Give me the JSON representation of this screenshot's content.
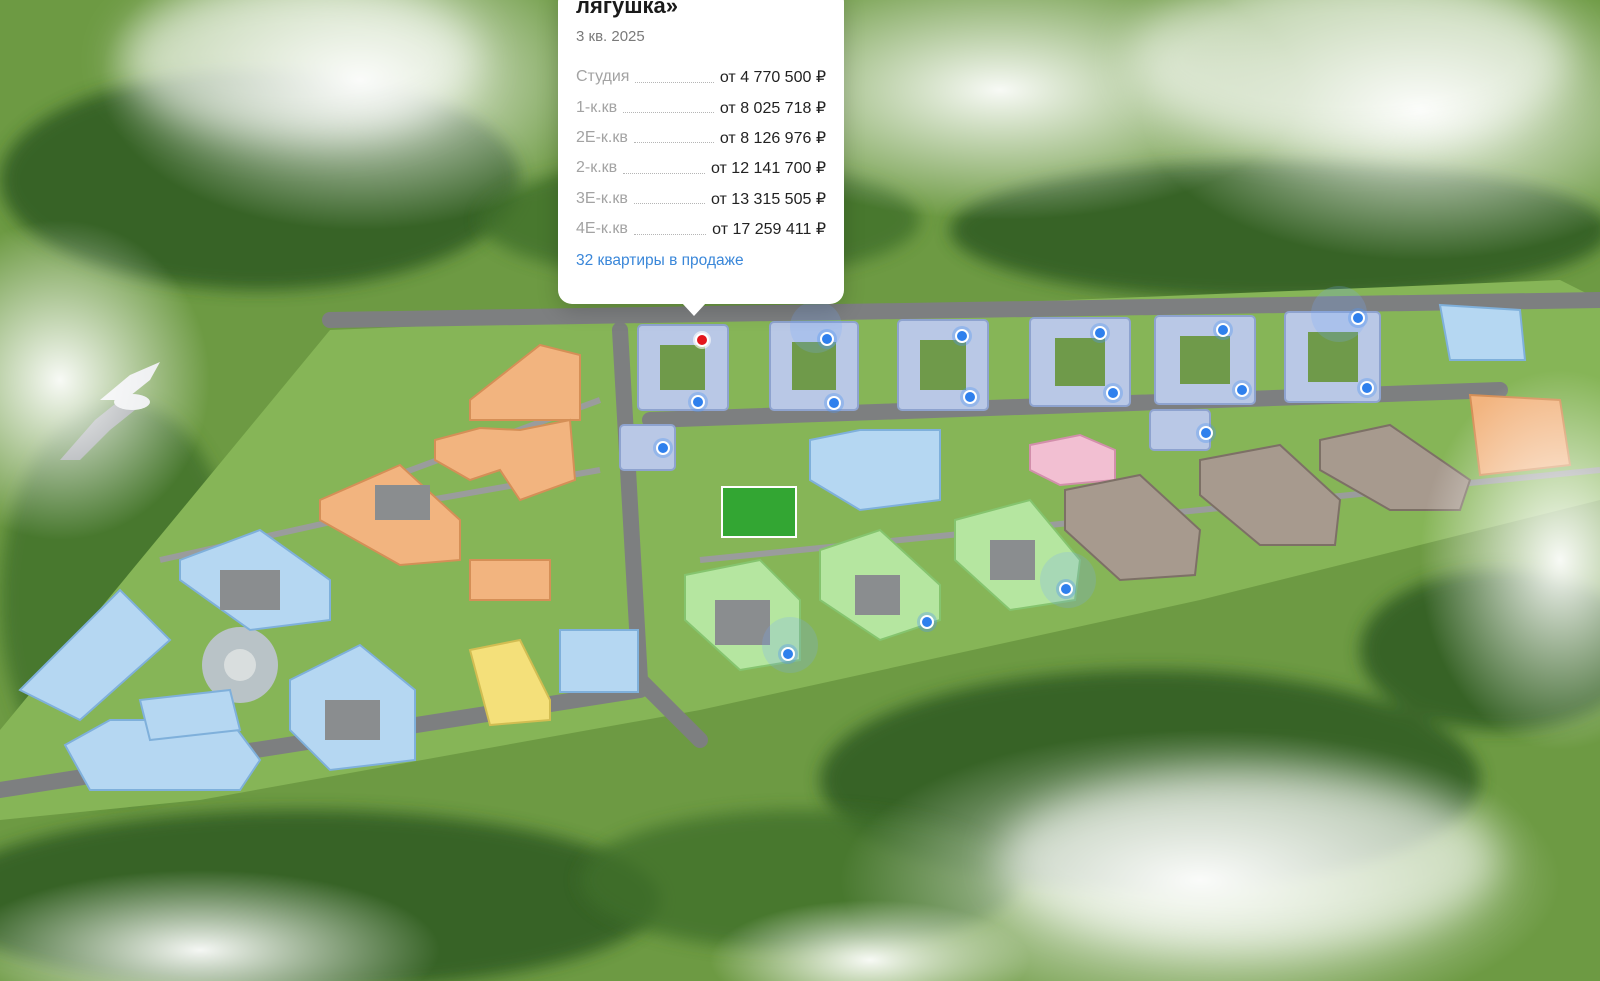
{
  "popup": {
    "title": "лягушка»",
    "delivery": "3 кв. 2025",
    "prices": [
      {
        "label": "Студия",
        "value": "от 4 770 500 ₽"
      },
      {
        "label": "1-к.кв",
        "value": "от 8 025 718 ₽"
      },
      {
        "label": "2Е-к.кв",
        "value": "от 8 126 976 ₽"
      },
      {
        "label": "2-к.кв",
        "value": "от 12 141 700 ₽"
      },
      {
        "label": "3Е-к.кв",
        "value": "от 13 315 505 ₽"
      },
      {
        "label": "4Е-к.кв",
        "value": "от 17 259 411 ₽"
      }
    ],
    "link_label": "32 квартиры в продаже"
  },
  "map": {
    "marker_icon": "location-dot-icon",
    "marker_color": "#2f80ed",
    "active_marker_color": "#e3161d",
    "markers_count": 18
  }
}
